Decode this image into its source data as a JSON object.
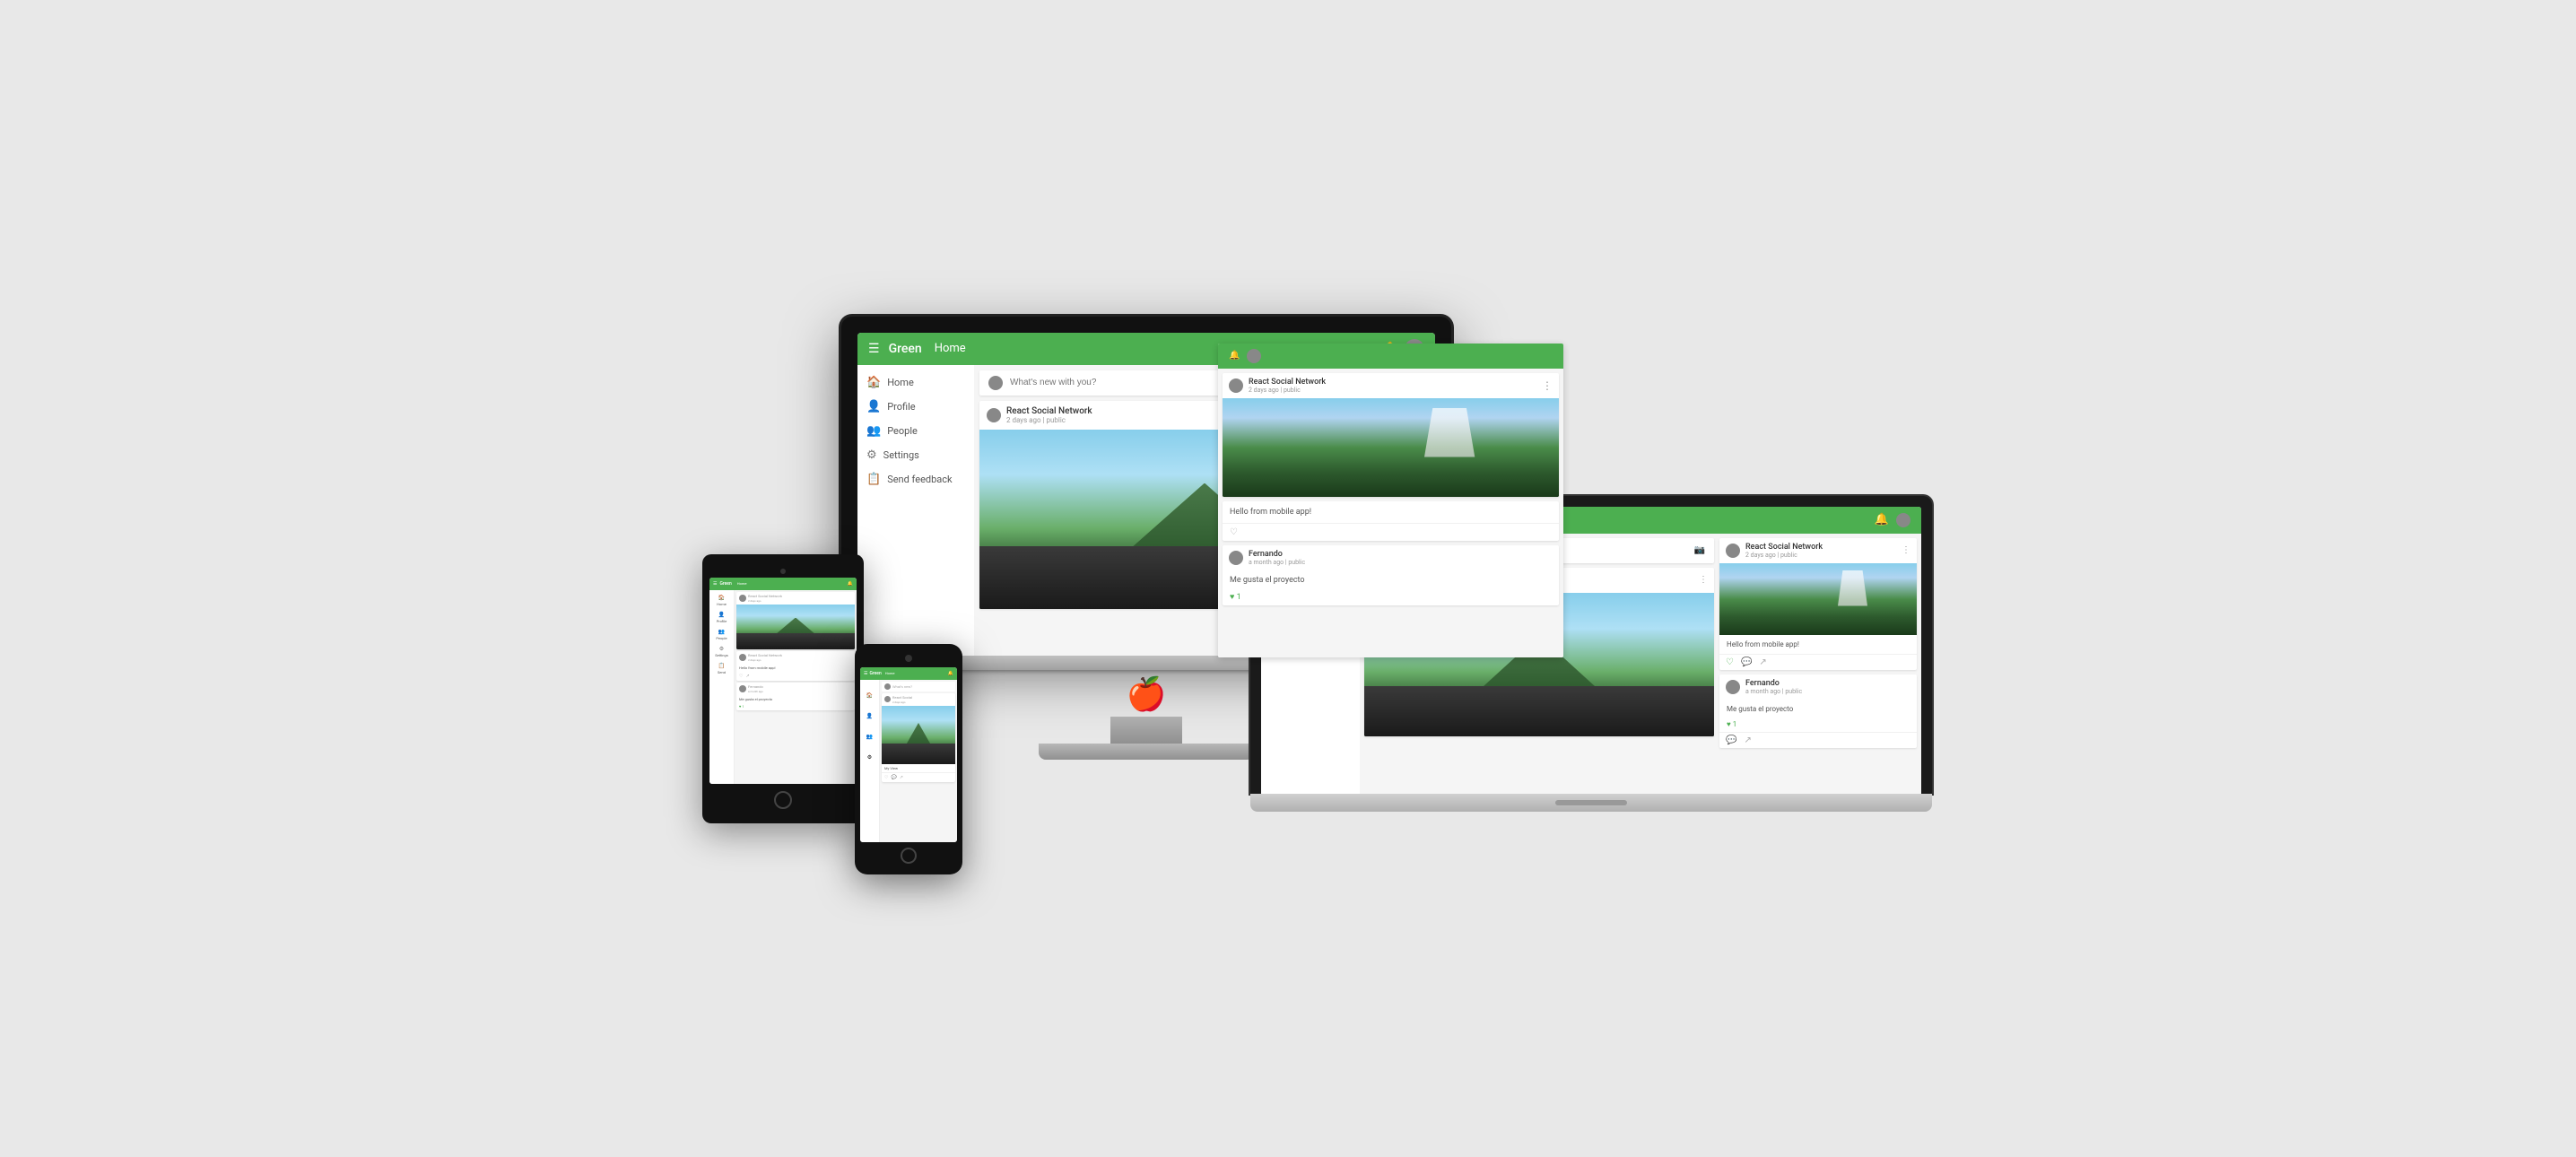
{
  "app": {
    "brand": "Green",
    "page": "Home",
    "nav": [
      {
        "label": "Home",
        "icon": "🏠"
      },
      {
        "label": "Profile",
        "icon": "👤"
      },
      {
        "label": "People",
        "icon": "👥"
      },
      {
        "label": "Settings",
        "icon": "⚙"
      },
      {
        "label": "Send feedback",
        "icon": "📋"
      }
    ],
    "compose_placeholder": "What's new with you?"
  },
  "posts": [
    {
      "author": "React Social Network",
      "meta": "2 days ago | public",
      "type": "landscape",
      "text": ""
    },
    {
      "author": "React Social Network",
      "meta": "2 days ago | public",
      "type": "waterfall",
      "text": "Hello from mobile app!",
      "likes": 0
    },
    {
      "author": "Fernando",
      "meta": "a month ago | public",
      "type": "text",
      "text": "Me gusta el proyecto",
      "likes": 1
    }
  ],
  "colors": {
    "green": "#4caf50",
    "bg": "#e8e8e8",
    "sidebar_bg": "#ffffff",
    "card_bg": "#ffffff",
    "text_primary": "#333333",
    "text_secondary": "#999999"
  }
}
